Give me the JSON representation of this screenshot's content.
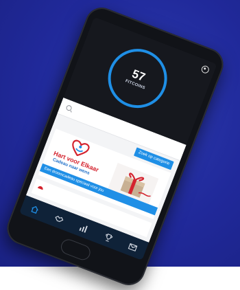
{
  "fitcoins": {
    "value": "57",
    "label": "FITCOINS"
  },
  "search": {
    "category_button": "Zoek op categorie"
  },
  "promo": {
    "brand_name": "Hart voor Elkaar",
    "tagline": "Cadeau naar wens",
    "banner": "Een droomcadeau speciaal voor jou"
  },
  "icons": [
    "account-icon",
    "search-icon",
    "home-icon",
    "handshake-icon",
    "stats-icon",
    "trophy-icon",
    "mail-icon"
  ],
  "colors": {
    "background": "#20299a",
    "accent": "#1f8fe6",
    "brand_red": "#d4232e",
    "tabbar": "#0f2238"
  }
}
